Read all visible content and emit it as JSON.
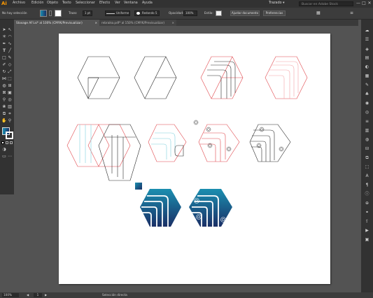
{
  "app": {
    "logo": "Ai"
  },
  "menu": {
    "items": [
      "Archivo",
      "Edición",
      "Objeto",
      "Texto",
      "Seleccionar",
      "Efecto",
      "Ver",
      "Ventana",
      "Ayuda"
    ]
  },
  "workspace": {
    "label": "Trazado",
    "chevron": "▾"
  },
  "search": {
    "placeholder": "Buscar en Adobe Stock"
  },
  "window_controls": {
    "minimize": "—",
    "maximize": "□",
    "close": "✕"
  },
  "control_bar": {
    "selection_status": "No hay selección",
    "stroke_label": "Trazo:",
    "stroke_value": "1 pt",
    "stroke_style": "Uniforme",
    "brush": "Redondo 5",
    "opacity_label": "Opacidad:",
    "opacity_value": "100%",
    "style_label": "Estilo:",
    "document_setup": "Ajustar documento",
    "preferences": "Preferencias"
  },
  "tabs": [
    {
      "label": "Stoxage AFI.ai* al 100% (CMYK/Previsualizar)",
      "close": "×"
    },
    {
      "label": "rebraiko.pdf* al 150% (CMYK/Previsualizar)",
      "close": "×"
    }
  ],
  "status_bar": {
    "zoom": "100%",
    "artboard_number": "1",
    "tool_status": "Selección directa"
  },
  "colors": {
    "accent_start": "#1b8fb0",
    "accent_end": "#1a2f66",
    "guide_red": "#e0474c",
    "line_black": "#2a2a2a",
    "guide_cyan": "#7fd0de"
  },
  "icons": {
    "toolbar": [
      "selection-tool-icon",
      "direct-selection-tool-icon",
      "magic-wand-icon",
      "lasso-icon",
      "pen-tool-icon",
      "curvature-tool-icon",
      "type-tool-icon",
      "line-tool-icon",
      "rectangle-tool-icon",
      "brush-icon",
      "pencil-icon",
      "eraser-icon",
      "rotate-icon",
      "scale-icon",
      "width-tool-icon",
      "free-transform-icon",
      "shape-builder-icon",
      "perspective-icon",
      "mesh-icon",
      "gradient-icon",
      "eyedropper-icon",
      "blend-icon",
      "symbol-sprayer-icon",
      "graph-icon",
      "artboard-tool-icon",
      "slice-icon",
      "hand-icon",
      "zoom-icon"
    ],
    "dock": [
      "libraries-icon",
      "properties-icon",
      "layers-icon",
      "artboards-icon",
      "color-icon",
      "swatches-icon",
      "brushes-icon",
      "symbols-icon",
      "graphic-styles-icon",
      "appearance-icon",
      "stroke-icon",
      "gradient-panel-icon",
      "transparency-icon",
      "align-icon",
      "pathfinder-icon",
      "transform-icon",
      "character-icon",
      "paragraph-icon",
      "info-icon",
      "navigator-icon",
      "links-icon",
      "asset-export-icon",
      "actions-icon",
      "document-info-icon"
    ]
  }
}
